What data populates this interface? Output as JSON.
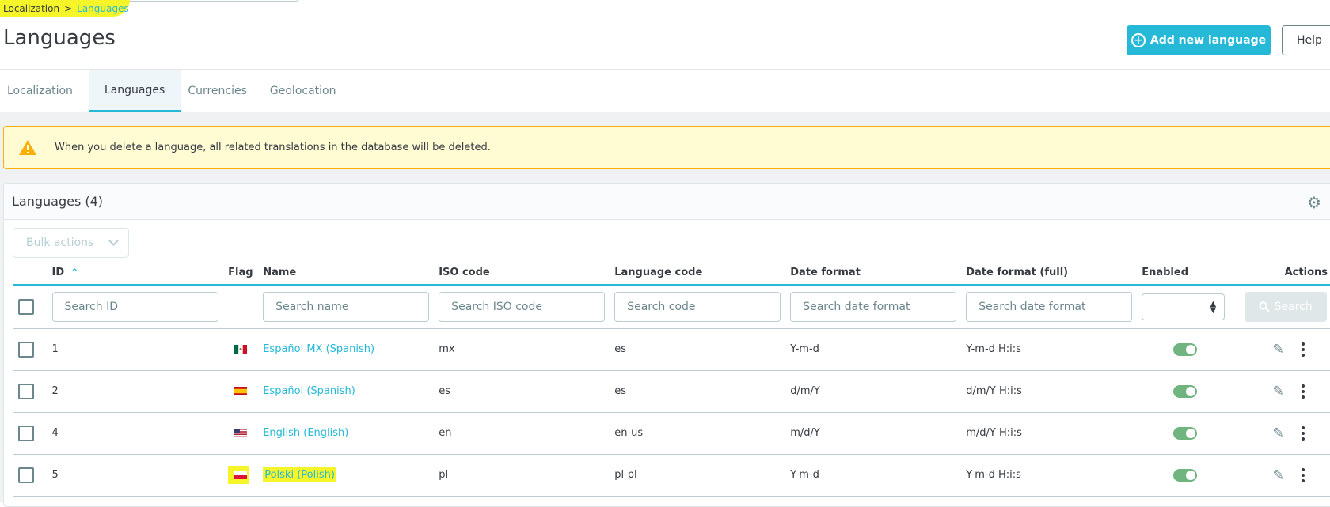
{
  "breadcrumb": {
    "parent": "Localization",
    "separator": ">",
    "current": "Languages"
  },
  "page_title": "Languages",
  "header_buttons": {
    "add": "Add new language",
    "help": "Help"
  },
  "tabs": [
    {
      "label": "Localization",
      "active": false
    },
    {
      "label": "Languages",
      "active": true
    },
    {
      "label": "Currencies",
      "active": false
    },
    {
      "label": "Geolocation",
      "active": false
    }
  ],
  "alert": {
    "text": "When you delete a language, all related translations in the database will be deleted."
  },
  "card": {
    "title": "Languages (4)"
  },
  "bulk_actions": "Bulk actions",
  "columns": {
    "id": "ID",
    "flag": "Flag",
    "name": "Name",
    "iso": "ISO code",
    "lang": "Language code",
    "date": "Date format",
    "date_full": "Date format (full)",
    "enabled": "Enabled",
    "actions": "Actions"
  },
  "filters": {
    "id": "Search ID",
    "name": "Search name",
    "iso": "Search ISO code",
    "lang": "Search code",
    "date": "Search date format",
    "date_full": "Search date format",
    "search_button": "Search"
  },
  "rows": [
    {
      "id": "1",
      "flag": "mx",
      "name": "Español MX (Spanish)",
      "iso": "mx",
      "lang": "es",
      "date": "Y-m-d",
      "date_full": "Y-m-d H:i:s",
      "enabled": true
    },
    {
      "id": "2",
      "flag": "es",
      "name": "Español (Spanish)",
      "iso": "es",
      "lang": "es",
      "date": "d/m/Y",
      "date_full": "d/m/Y H:i:s",
      "enabled": true
    },
    {
      "id": "4",
      "flag": "us",
      "name": "English (English)",
      "iso": "en",
      "lang": "en-us",
      "date": "m/d/Y",
      "date_full": "m/d/Y H:i:s",
      "enabled": true
    },
    {
      "id": "5",
      "flag": "pl",
      "name": "Polski (Polish)",
      "iso": "pl",
      "lang": "pl-pl",
      "date": "Y-m-d",
      "date_full": "Y-m-d H:i:s",
      "enabled": true
    }
  ],
  "colors": {
    "accent": "#25b9d7",
    "highlight": "#f5f52a",
    "toggle_on": "#70b580",
    "alert_bg": "#fffbd3",
    "alert_border": "#fab000"
  }
}
